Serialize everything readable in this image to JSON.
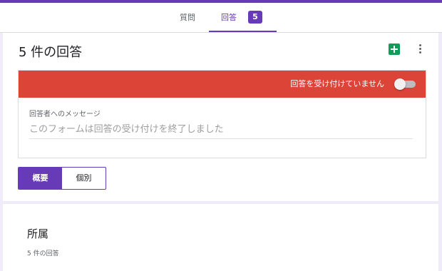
{
  "tabs": {
    "questions_label": "質問",
    "responses_label": "回答",
    "responses_count": "5"
  },
  "summary_card": {
    "title": "5 件の回答",
    "accepting_banner": "回答を受け付けていません",
    "accepting_toggle_on": false,
    "message_label": "回答者へのメッセージ",
    "message_placeholder": "このフォームは回答の受け付けを終了しました",
    "view_options": [
      "概要",
      "個別"
    ],
    "selected_view": "概要"
  },
  "question_card": {
    "title": "所属",
    "response_count": "5 件の回答"
  },
  "icons": {
    "sheets": "google-sheets-icon",
    "more": "more-vert-icon"
  },
  "colors": {
    "accent": "#673ab7",
    "banner": "#db4437",
    "sheets": "#0f9d58"
  }
}
